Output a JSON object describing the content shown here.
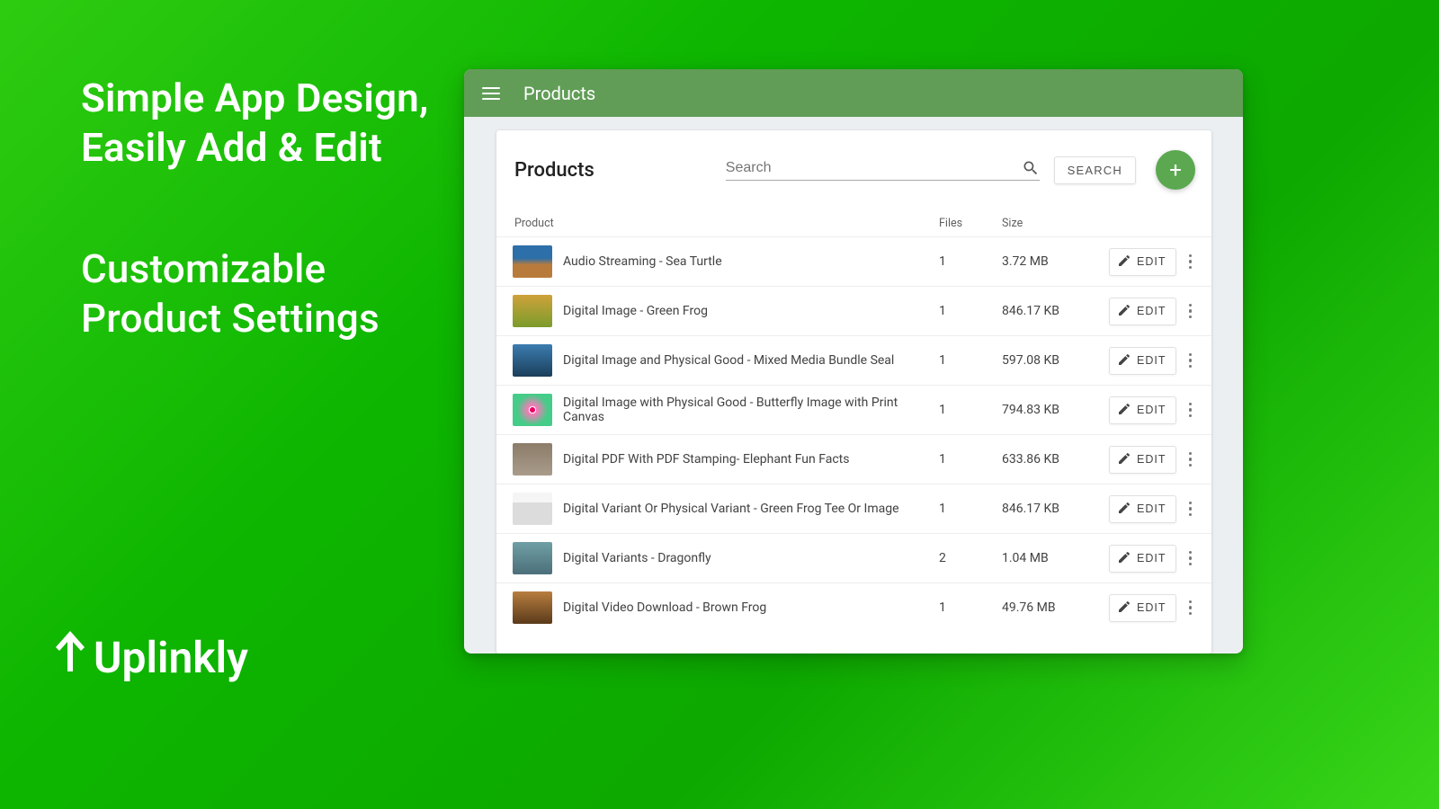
{
  "marketing": {
    "headline1": "Simple App Design, Easily Add & Edit",
    "headline2": "Customizable Product Settings",
    "brand": "Uplinkly"
  },
  "appbar": {
    "title": "Products"
  },
  "card": {
    "title": "Products",
    "search_placeholder": "Search",
    "search_button": "SEARCH",
    "add_label": "+"
  },
  "columns": {
    "product": "Product",
    "files": "Files",
    "size": "Size"
  },
  "edit_label": "EDIT",
  "rows": [
    {
      "name": "Audio Streaming - Sea Turtle",
      "files": "1",
      "size": "3.72 MB"
    },
    {
      "name": "Digital Image - Green Frog",
      "files": "1",
      "size": "846.17 KB"
    },
    {
      "name": "Digital Image and Physical Good - Mixed Media Bundle Seal",
      "files": "1",
      "size": "597.08 KB"
    },
    {
      "name": "Digital Image with Physical Good - Butterfly Image with Print Canvas",
      "files": "1",
      "size": "794.83 KB"
    },
    {
      "name": "Digital PDF With PDF Stamping- Elephant Fun Facts",
      "files": "1",
      "size": "633.86 KB"
    },
    {
      "name": "Digital Variant Or Physical Variant - Green Frog Tee Or Image",
      "files": "1",
      "size": "846.17 KB"
    },
    {
      "name": "Digital Variants - Dragonfly",
      "files": "2",
      "size": "1.04 MB"
    },
    {
      "name": "Digital Video Download - Brown Frog",
      "files": "1",
      "size": "49.76 MB"
    }
  ]
}
